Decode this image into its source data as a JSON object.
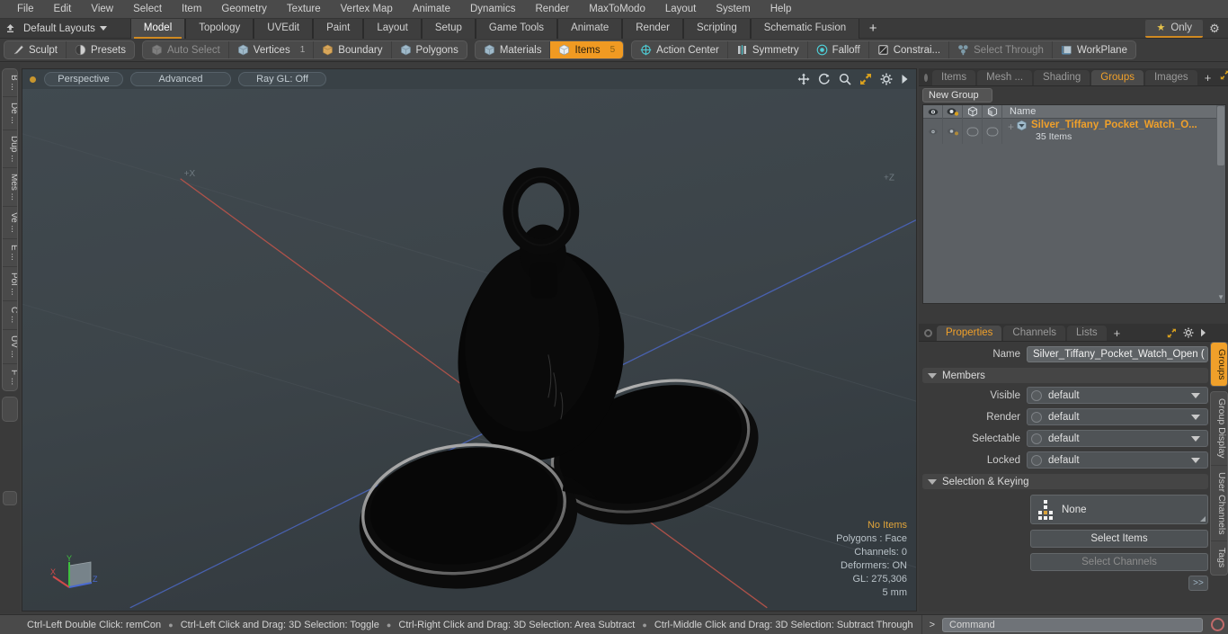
{
  "menu": {
    "items": [
      "File",
      "Edit",
      "View",
      "Select",
      "Item",
      "Geometry",
      "Texture",
      "Vertex Map",
      "Animate",
      "Dynamics",
      "Render",
      "MaxToModo",
      "Layout",
      "System",
      "Help"
    ]
  },
  "layout_bar": {
    "preset_label": "Default Layouts",
    "tabs": [
      "Model",
      "Topology",
      "UVEdit",
      "Paint",
      "Layout",
      "Setup",
      "Game Tools",
      "Animate",
      "Render",
      "Scripting",
      "Schematic Fusion"
    ],
    "active_tab": "Model",
    "add_label": "+",
    "only_label": "Only",
    "gear_icon": "gear-icon",
    "star_icon": "star-icon"
  },
  "mode_toolbar": {
    "group1": [
      {
        "label": "Sculpt",
        "icon": "brush-icon",
        "state": "normal"
      },
      {
        "label": "Presets",
        "icon": "sphere-icon",
        "state": "normal"
      }
    ],
    "group2": [
      {
        "label": "Auto Select",
        "icon": "cube-icon",
        "state": "dim",
        "count": ""
      },
      {
        "label": "Vertices",
        "icon": "cube-icon",
        "state": "normal",
        "count": "1"
      },
      {
        "label": "Boundary",
        "icon": "cube-icon",
        "state": "normal",
        "count": ""
      },
      {
        "label": "Polygons",
        "icon": "cube-icon",
        "state": "normal",
        "count": ""
      }
    ],
    "group3": [
      {
        "label": "Materials",
        "icon": "cube-icon",
        "state": "normal",
        "count": ""
      },
      {
        "label": "Items",
        "icon": "cube-icon",
        "state": "active",
        "count": "5"
      }
    ],
    "group4": [
      {
        "label": "Action Center",
        "icon": "crosshair-icon",
        "state": "normal"
      },
      {
        "label": "Symmetry",
        "icon": "symmetry-icon",
        "state": "normal"
      },
      {
        "label": "Falloff",
        "icon": "falloff-icon",
        "state": "normal"
      },
      {
        "label": "Constrai...",
        "icon": "constraint-icon",
        "state": "normal"
      },
      {
        "label": "Select Through",
        "icon": "select-through-icon",
        "state": "dim"
      },
      {
        "label": "WorkPlane",
        "icon": "workplane-icon",
        "state": "normal"
      }
    ]
  },
  "left_tool_tabs": [
    "B ...",
    "De ...",
    "Dup ...",
    "Mes ...",
    "Ve ...",
    "E ...",
    "Pol ...",
    "C ...",
    "UV ...",
    "F ..."
  ],
  "viewport": {
    "view_mode": "Perspective",
    "shading": "Advanced",
    "raygl": "Ray GL: Off",
    "header_icons": [
      "move-icon",
      "rotate-icon",
      "zoom-icon",
      "fit-icon",
      "gear-icon",
      "chevron-right-icon"
    ],
    "axis_labels": {
      "x": "+X",
      "z": "+Z"
    },
    "stats": {
      "selection": "No Items",
      "polygons": "Polygons : Face",
      "channels": "Channels: 0",
      "deformers": "Deformers: ON",
      "gl": "GL: 275,306",
      "scale": "5 mm"
    },
    "gizmo": {
      "x": "X",
      "y": "Y",
      "z": "Z"
    }
  },
  "item_panel": {
    "tabs": [
      "Items",
      "Mesh ...",
      "Shading",
      "Groups",
      "Images"
    ],
    "active_tab": "Groups",
    "add_label": "+",
    "new_group_label": "New Group",
    "column_header_name": "Name",
    "column_icons": [
      "eye-icon",
      "render-icon",
      "wireframe-icon",
      "shaded-icon"
    ],
    "rows": [
      {
        "name": "Silver_Tiffany_Pocket_Watch_O...",
        "sub": "35 Items",
        "expander": "+"
      }
    ]
  },
  "properties": {
    "tabs": [
      "Properties",
      "Channels",
      "Lists"
    ],
    "active_tab": "Properties",
    "add_label": "+",
    "name_label": "Name",
    "name_value": "Silver_Tiffany_Pocket_Watch_Open (",
    "members_section": "Members",
    "fields": [
      {
        "label": "Visible",
        "value": "default"
      },
      {
        "label": "Render",
        "value": "default"
      },
      {
        "label": "Selectable",
        "value": "default"
      },
      {
        "label": "Locked",
        "value": "default"
      }
    ],
    "selection_section": "Selection & Keying",
    "set_value": "None",
    "select_items_label": "Select Items",
    "select_channels_label": "Select Channels",
    "more_label": ">>"
  },
  "right_vtabs": [
    {
      "label": "Groups",
      "active": true
    },
    {
      "label": "Group Display",
      "active": false
    },
    {
      "label": "User Channels",
      "active": false
    },
    {
      "label": "Tags",
      "active": false
    }
  ],
  "status_bar": {
    "hints": [
      "Ctrl-Left Double Click: remCon",
      "Ctrl-Left Click and Drag: 3D Selection: Toggle",
      "Ctrl-Right Click and Drag: 3D Selection: Area Subtract",
      "Ctrl-Middle Click and Drag: 3D Selection: Subtract Through"
    ],
    "prompt": ">",
    "command_placeholder": "Command",
    "record_icon": "record-icon"
  },
  "colors": {
    "accent_orange": "#f0a02a",
    "tab_underline": "#d08a21",
    "viewport_bg": "#3d454a",
    "panel_bg": "#3a3a3a",
    "list_bg": "#5c6064",
    "axis_x": "#b5534a",
    "axis_z": "#4a63b5"
  }
}
